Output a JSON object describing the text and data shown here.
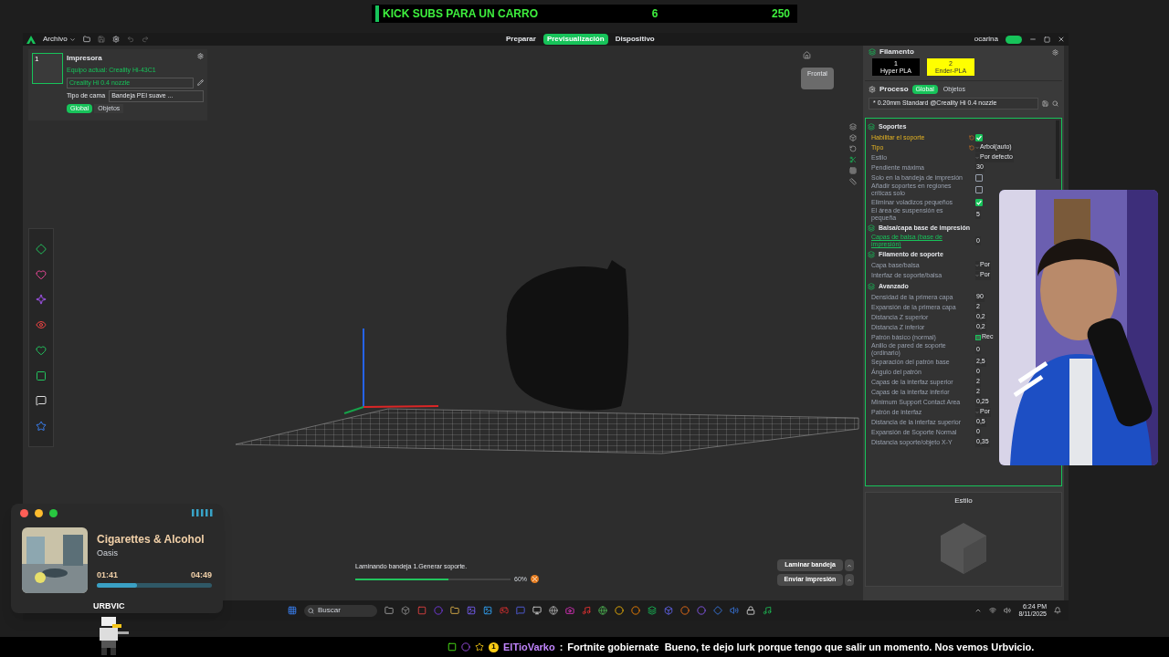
{
  "banner": {
    "title": "KICK SUBS PARA UN CARRO",
    "count": "6",
    "goal": "250"
  },
  "window": {
    "menu": "Archivo",
    "tabs": [
      {
        "label": "Preparar",
        "selected": false
      },
      {
        "label": "Previsualización",
        "selected": true
      },
      {
        "label": "Dispositivo",
        "selected": false
      }
    ],
    "user": "ocarina",
    "cloud_on": true
  },
  "printer_panel": {
    "thumb_number": "1",
    "title": "Impresora",
    "current": "Equipo actual: Creality Hi-43C1",
    "nozzle": "Creality Hi 0.4 nozzle",
    "bed_label": "Tipo de cama",
    "bed": "Bandeja PEI suave ...",
    "toggles": [
      {
        "label": "Global",
        "selected": true
      },
      {
        "label": "Objetos",
        "selected": false
      }
    ]
  },
  "view_cube": "Frontal",
  "progress": {
    "text": "Laminando bandeja 1.Generar soporte.",
    "level": 0.6,
    "percent": "60%"
  },
  "actions": [
    "Laminar bandeja",
    "Enviar impresión"
  ],
  "filament": {
    "title": "Filamento",
    "slots": [
      {
        "number": "1",
        "name": "Hyper PLA",
        "color": "#000000"
      },
      {
        "number": "2",
        "name": "Ender-PLA",
        "color": "#ffff00"
      }
    ]
  },
  "process": {
    "title": "Proceso",
    "toggles": [
      {
        "label": "Global",
        "selected": true
      },
      {
        "label": "Objetos",
        "selected": false
      }
    ],
    "preset": "* 0.20mm Standard @Creality Hi 0.4 nozzle"
  },
  "settings": [
    {
      "kind": "section",
      "label": "Soportes"
    },
    {
      "kind": "check",
      "label": "Habilitar el soporte",
      "checked": true,
      "modified": true
    },
    {
      "kind": "select",
      "label": "Tipo",
      "value": "Arbol(auto)",
      "modified": true
    },
    {
      "kind": "select",
      "label": "Estilo",
      "value": "Por defecto",
      "modified": false
    },
    {
      "kind": "number",
      "label": "Pendiente máxima",
      "value": "30",
      "modified": false
    },
    {
      "kind": "check",
      "label": "Solo en la bandeja de impresión",
      "checked": false,
      "modified": false
    },
    {
      "kind": "check",
      "label": "Añadir soportes en regiones críticas solo",
      "checked": false,
      "modified": false
    },
    {
      "kind": "check",
      "label": "Eliminar voladizos pequeños",
      "checked": true,
      "modified": false
    },
    {
      "kind": "number",
      "label": "El área de suspensión es pequeña",
      "value": "5",
      "modified": false
    },
    {
      "kind": "section",
      "label": "Balsa/capa base de impresión"
    },
    {
      "kind": "link",
      "label": "Capas de balsa (base de impresión)",
      "value": "0",
      "modified": false
    },
    {
      "kind": "section",
      "label": "Filamento de soporte"
    },
    {
      "kind": "select",
      "label": "Capa base/balsa",
      "value": "Por",
      "modified": false
    },
    {
      "kind": "select",
      "label": "Interfaz de soporte/balsa",
      "value": "Por",
      "modified": false
    },
    {
      "kind": "section",
      "label": "Avanzado"
    },
    {
      "kind": "number",
      "label": "Densidad de la primera capa",
      "value": "90",
      "modified": false
    },
    {
      "kind": "number",
      "label": "Expansión de la primera capa",
      "value": "2",
      "modified": false
    },
    {
      "kind": "number",
      "label": "Distancia Z superior",
      "value": "0,2",
      "modified": false
    },
    {
      "kind": "number",
      "label": "Distancia Z inferior",
      "value": "0,2",
      "modified": false
    },
    {
      "kind": "pattern",
      "label": "Patrón básico (normal)",
      "value": "Rec",
      "modified": false
    },
    {
      "kind": "number",
      "label": "Anillo de pared de soporte (ordinario)",
      "value": "0",
      "modified": false
    },
    {
      "kind": "number",
      "label": "Separación del patrón base",
      "value": "2,5",
      "modified": false
    },
    {
      "kind": "number",
      "label": "Ángulo del patrón",
      "value": "0",
      "modified": false
    },
    {
      "kind": "number",
      "label": "Capas de la interfaz superior",
      "value": "2",
      "modified": false
    },
    {
      "kind": "number",
      "label": "Capas de la interfaz inferior",
      "value": "2",
      "modified": false
    },
    {
      "kind": "number",
      "label": "Minimum Support Contact Area",
      "value": "0,25",
      "modified": false
    },
    {
      "kind": "select",
      "label": "Patrón de interfaz",
      "value": "Por",
      "modified": false
    },
    {
      "kind": "number",
      "label": "Distancia de la interfaz superior",
      "value": "0,5",
      "modified": false
    },
    {
      "kind": "number",
      "label": "Expansión de Soporte Normal",
      "value": "0",
      "modified": false
    },
    {
      "kind": "number",
      "label": "Distancia soporte/objeto X-Y",
      "value": "0,35",
      "modified": false
    }
  ],
  "style_panel": {
    "title": "Estilo"
  },
  "taskbar": {
    "search_placeholder": "Buscar",
    "time": "6:24 PM",
    "date": "8/11/2025"
  },
  "music": {
    "title": "Cigarettes & Alcohol",
    "artist": "Oasis",
    "elapsed": "01:41",
    "total": "04:49",
    "level": 0.35,
    "user": "URBVIC"
  },
  "chat": {
    "badge": "1",
    "user": "ElTioVarko",
    "separator": ":",
    "message": "Fortnite gobiernate  Bueno, te dejo lurk porque tengo que salir un momento. Nos vemos Urbvicio."
  }
}
